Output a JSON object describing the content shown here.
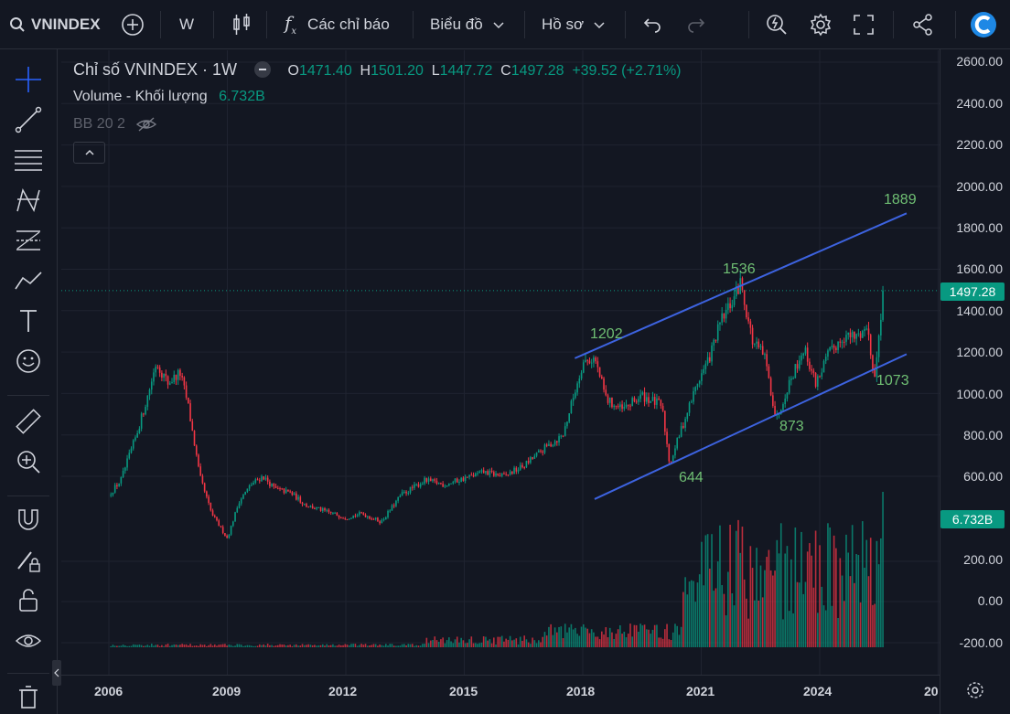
{
  "topbar": {
    "symbol": "VNINDEX",
    "interval": "W",
    "indicators_label": "Các chỉ báo",
    "chart_label": "Biểu đồ",
    "profile_label": "Hồ sơ"
  },
  "legend": {
    "title": "Chỉ số VNINDEX · 1W",
    "open_label": "O",
    "open": "1471.40",
    "high_label": "H",
    "high": "1501.20",
    "low_label": "L",
    "low": "1447.72",
    "close_label": "C",
    "close": "1497.28",
    "change": "+39.52 (+2.71%)",
    "volume_label": "Volume - Khối lượng",
    "volume_value": "6.732B",
    "bb_label": "BB 20 2"
  },
  "price_axis": [
    "2600.00",
    "2400.00",
    "2200.00",
    "2000.00",
    "1800.00",
    "1600.00",
    "1400.00",
    "1200.00",
    "1000.00",
    "800.00",
    "600.00"
  ],
  "volume_axis": [
    "200.00",
    "0.00",
    "-200.00"
  ],
  "last_price_tag": "1497.28",
  "volume_tag": "6.732B",
  "time_axis": [
    "2006",
    "2009",
    "2012",
    "2015",
    "2018",
    "2021",
    "2024",
    "20"
  ],
  "colors": {
    "up": "#089981",
    "down": "#f23645",
    "channel": "#3d63e0",
    "annotation": "#6fbf73",
    "bg": "#131722"
  },
  "chart_data": {
    "type": "line",
    "title": "Chỉ số VNINDEX · 1W",
    "x": [
      2006.0,
      2006.3,
      2006.7,
      2007.0,
      2007.2,
      2007.5,
      2007.8,
      2008.0,
      2008.3,
      2008.6,
      2009.0,
      2009.3,
      2009.6,
      2009.9,
      2010.2,
      2010.6,
      2011.0,
      2011.5,
      2012.0,
      2012.4,
      2012.9,
      2013.4,
      2014.0,
      2014.5,
      2015.0,
      2015.5,
      2016.0,
      2016.5,
      2017.0,
      2017.5,
      2018.0,
      2018.3,
      2018.6,
      2019.0,
      2019.5,
      2020.0,
      2020.2,
      2020.5,
      2020.9,
      2021.2,
      2021.5,
      2021.8,
      2022.0,
      2022.3,
      2022.6,
      2022.9,
      2023.2,
      2023.6,
      2023.9,
      2024.2,
      2024.6,
      2024.9,
      2025.2,
      2025.4,
      2025.6
    ],
    "y": [
      510,
      580,
      800,
      1000,
      1150,
      1050,
      1100,
      950,
      600,
      420,
      300,
      480,
      560,
      600,
      540,
      520,
      460,
      430,
      400,
      420,
      380,
      510,
      580,
      560,
      590,
      620,
      600,
      650,
      730,
      800,
      1150,
      1170,
      970,
      920,
      990,
      940,
      660,
      830,
      1050,
      1170,
      1350,
      1450,
      1536,
      1250,
      1180,
      873,
      1040,
      1220,
      1050,
      1180,
      1280,
      1270,
      1320,
      1073,
      1497
    ],
    "volume": {
      "axis": [
        -200,
        200
      ],
      "note": "weekly traded volume bars, rising sharply after 2020, last bar 6.732B"
    },
    "annotations": [
      {
        "text": "1202",
        "x": 2018.2,
        "y": 1202
      },
      {
        "text": "644",
        "x": 2020.2,
        "y": 644
      },
      {
        "text": "1536",
        "x": 2022.0,
        "y": 1536
      },
      {
        "text": "873",
        "x": 2022.9,
        "y": 873
      },
      {
        "text": "1073",
        "x": 2025.4,
        "y": 1073
      },
      {
        "text": "1889",
        "x": 2026.1,
        "y": 1889
      }
    ],
    "channel": {
      "upper": [
        [
          2017.8,
          1170
        ],
        [
          2026.2,
          1870
        ]
      ],
      "lower": [
        [
          2018.3,
          490
        ],
        [
          2026.2,
          1190
        ]
      ]
    },
    "ylim": [
      430,
      2650
    ],
    "xlim": [
      2005.5,
      2026.7
    ],
    "grid": true
  }
}
